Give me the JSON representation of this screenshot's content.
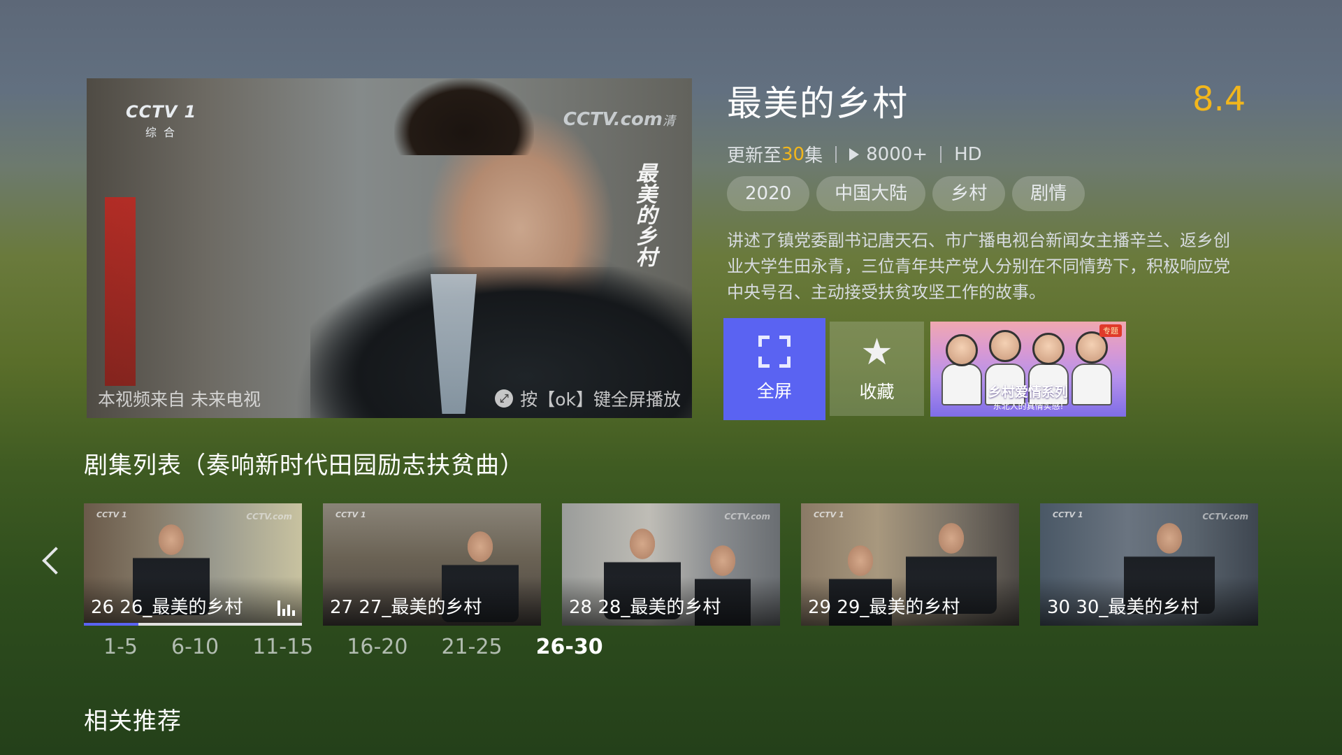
{
  "player": {
    "channel_logo": "CCTV 1",
    "channel_sub": "综合",
    "watermark": "CCTV.com",
    "watermark_sub": "清",
    "overlay_title": "最美的乡村",
    "source_caption": "本视频来自 未来电视",
    "fullscreen_hint": "按【ok】键全屏播放"
  },
  "show": {
    "title": "最美的乡村",
    "rating": "8.4",
    "update_prefix": "更新至",
    "update_count": "30",
    "update_suffix": "集",
    "plays": "8000+",
    "quality": "HD",
    "tags": [
      "2020",
      "中国大陆",
      "乡村",
      "剧情"
    ],
    "description": "讲述了镇党委副书记唐天石、市广播电视台新闻女主播辛兰、返乡创业大学生田永青，三位青年共产党人分别在不同情势下，积极响应党中央号召、主动接受扶贫攻坚工作的故事。"
  },
  "actions": {
    "fullscreen_label": "全屏",
    "favorite_label": "收藏"
  },
  "promo": {
    "badge": "专题",
    "title": "乡村爱情系列",
    "subtitle": "东北人的真情实感!"
  },
  "episodes_section": {
    "title": "剧集列表（奏响新时代田园励志扶贫曲）",
    "items": [
      {
        "label": "26 26_最美的乡村",
        "playing": true,
        "progress": 0.25
      },
      {
        "label": "27 27_最美的乡村"
      },
      {
        "label": "28 28_最美的乡村"
      },
      {
        "label": "29 29_最美的乡村"
      },
      {
        "label": "30 30_最美的乡村"
      }
    ],
    "ranges": [
      "1-5",
      "6-10",
      "11-15",
      "16-20",
      "21-25",
      "26-30"
    ],
    "active_range": "26-30"
  },
  "related_section": {
    "title": "相关推荐"
  },
  "colors": {
    "accent": "#5a63f2",
    "rating": "#f2b61c"
  }
}
